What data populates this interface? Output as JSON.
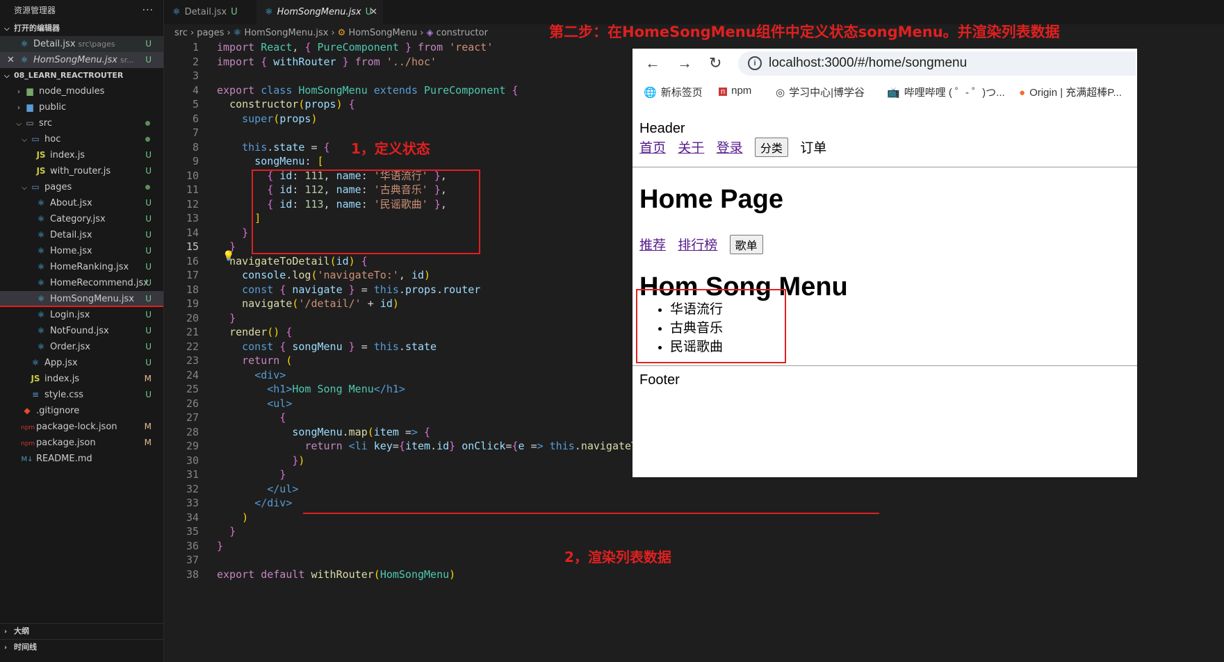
{
  "explorer": {
    "title": "资源管理器",
    "open_editors_label": "打开的编辑器",
    "open_editors": [
      {
        "name": "Detail.jsx",
        "path": "src\\pages",
        "status": "U"
      },
      {
        "name": "HomSongMenu.jsx",
        "path": "sr...",
        "status": "U"
      }
    ],
    "project_label": "08_LEARN_REACTROUTER",
    "tree": [
      {
        "name": "node_modules",
        "status": ""
      },
      {
        "name": "public",
        "status": ""
      },
      {
        "name": "src",
        "status": ""
      },
      {
        "name": "hoc",
        "status": ""
      },
      {
        "name": "index.js",
        "status": "U"
      },
      {
        "name": "with_router.js",
        "status": "U"
      },
      {
        "name": "pages",
        "status": ""
      },
      {
        "name": "About.jsx",
        "status": "U"
      },
      {
        "name": "Category.jsx",
        "status": "U"
      },
      {
        "name": "Detail.jsx",
        "status": "U"
      },
      {
        "name": "Home.jsx",
        "status": "U"
      },
      {
        "name": "HomeRanking.jsx",
        "status": "U"
      },
      {
        "name": "HomeRecommend.jsx",
        "status": "U"
      },
      {
        "name": "HomSongMenu.jsx",
        "status": "U"
      },
      {
        "name": "Login.jsx",
        "status": "U"
      },
      {
        "name": "NotFound.jsx",
        "status": "U"
      },
      {
        "name": "Order.jsx",
        "status": "U"
      },
      {
        "name": "App.jsx",
        "status": "U"
      },
      {
        "name": "index.js",
        "status": "M"
      },
      {
        "name": "style.css",
        "status": "U"
      },
      {
        "name": ".gitignore",
        "status": ""
      },
      {
        "name": "package-lock.json",
        "status": "M"
      },
      {
        "name": "package.json",
        "status": "M"
      },
      {
        "name": "README.md",
        "status": ""
      }
    ],
    "outline_label": "大纲",
    "timeline_label": "时间线"
  },
  "tabs": [
    {
      "name": "Detail.jsx",
      "status": "U"
    },
    {
      "name": "HomSongMenu.jsx",
      "status": "U"
    }
  ],
  "breadcrumb": [
    "src",
    "pages",
    "HomSongMenu.jsx",
    "HomSongMenu",
    "constructor"
  ],
  "current_line": "15",
  "code_lines": [
    "import React, { PureComponent } from 'react'",
    "import { withRouter } from '../hoc'",
    "",
    "export class HomSongMenu extends PureComponent {",
    "  constructor(props) {",
    "    super(props)",
    "",
    "    this.state = {",
    "      songMenu: [",
    "        { id: 111, name: '华语流行' },",
    "        { id: 112, name: '古典音乐' },",
    "        { id: 113, name: '民谣歌曲' },",
    "      ]",
    "    }",
    "  }",
    "  navigateToDetail(id) {",
    "    console.log('navigateTo:', id)",
    "    const { navigate } = this.props.router",
    "    navigate('/detail/' + id)",
    "  }",
    "  render() {",
    "    const { songMenu } = this.state",
    "    return (",
    "      <div>",
    "        <h1>Hom Song Menu</h1>",
    "        <ul>",
    "          {",
    "            songMenu.map(item => {",
    "              return <li key={item.id} onClick={e => this.navigateToDetail(item.id)}>{item.name}</li>",
    "            })",
    "          }",
    "        </ul>",
    "      </div>",
    "    )",
    "  }",
    "}",
    "",
    "export default withRouter(HomSongMenu)"
  ],
  "annotations": {
    "step_title": "第二步：在HomeSongMenu组件中定义状态songMenu。并渲染列表数据",
    "note1": "1，定义状态",
    "note2": "2，渲染列表数据"
  },
  "browser": {
    "url": "localhost:3000/#/home/songmenu",
    "bookmarks": [
      "新标签页",
      "npm",
      "学习中心|博学谷",
      "哔哩哔哩 ( ゜- ゜)つ...",
      "Origin | 充满超棒P..."
    ],
    "header": "Header",
    "nav": [
      "首页",
      "关于",
      "登录",
      "分类",
      "订单"
    ],
    "home_title": "Home Page",
    "sub_nav": [
      "推荐",
      "排行榜",
      "歌单"
    ],
    "menu_title": "Hom Song Menu",
    "list": [
      "华语流行",
      "古典音乐",
      "民谣歌曲"
    ],
    "footer": "Footer"
  }
}
